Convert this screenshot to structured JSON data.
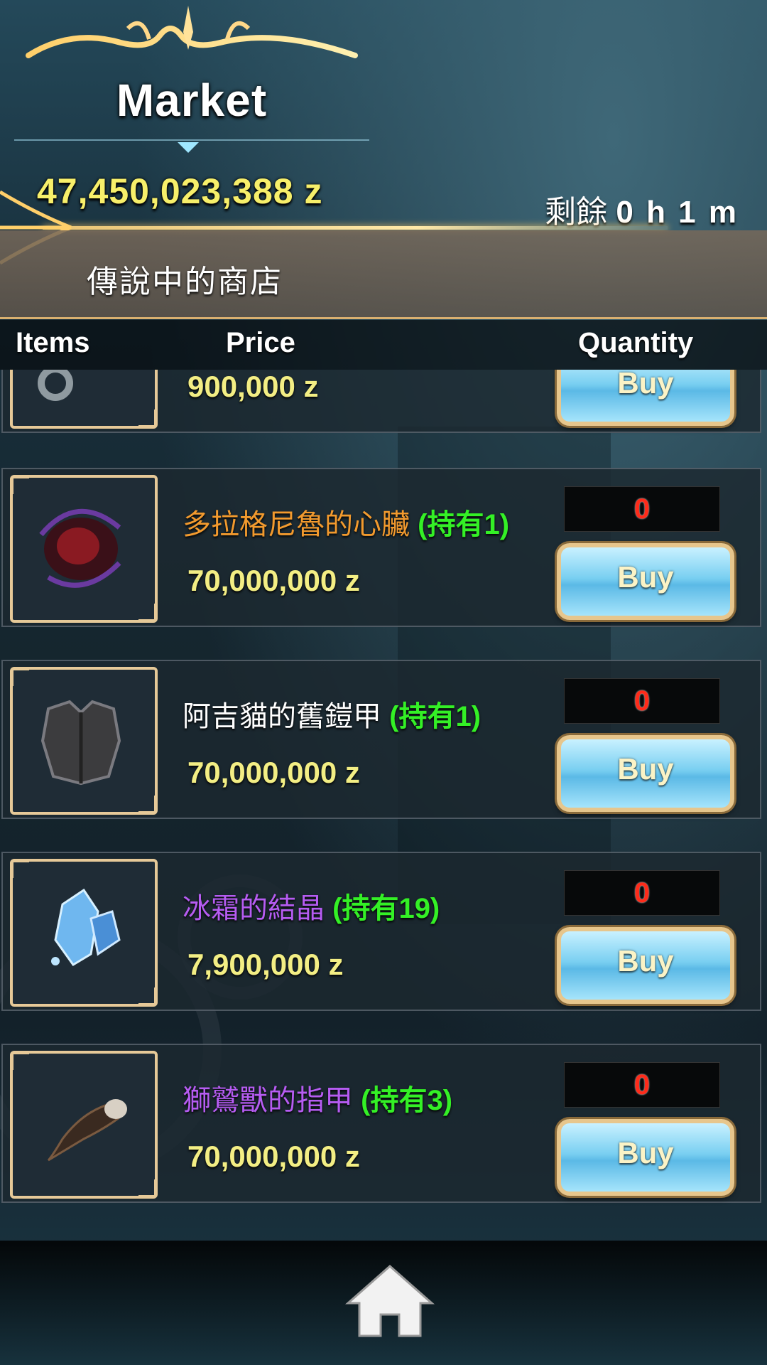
{
  "header": {
    "title": "Market",
    "money": "47,450,023,388 z",
    "timer_label": "剩餘",
    "timer_value": "0 h 1 m",
    "shop_name": "傳說中的商店"
  },
  "columns": {
    "items": "Items",
    "price": "Price",
    "quantity": "Quantity"
  },
  "rows": [
    {
      "name": "",
      "owned": "",
      "price": "900,000 z",
      "quantity": "",
      "buy_label": "Buy",
      "icon": "ring-icon"
    },
    {
      "name": "多拉格尼魯的心臟",
      "name_color": "#f29a2e",
      "owned": "(持有1)",
      "price": "70,000,000 z",
      "quantity": "0",
      "buy_label": "Buy",
      "icon": "dark-heart-icon"
    },
    {
      "name": "阿吉貓的舊鎧甲",
      "name_color": "#ffffff",
      "owned": "(持有1)",
      "price": "70,000,000 z",
      "quantity": "0",
      "buy_label": "Buy",
      "icon": "armor-icon"
    },
    {
      "name": "冰霜的結晶",
      "name_color": "#b65cf2",
      "owned": "(持有19)",
      "price": "7,900,000 z",
      "quantity": "0",
      "buy_label": "Buy",
      "icon": "ice-crystal-icon"
    },
    {
      "name": "獅鷲獸的指甲",
      "name_color": "#b65cf2",
      "owned": "(持有3)",
      "price": "70,000,000 z",
      "quantity": "0",
      "buy_label": "Buy",
      "icon": "claw-icon"
    }
  ],
  "footer": {
    "home_icon": "home-icon"
  }
}
